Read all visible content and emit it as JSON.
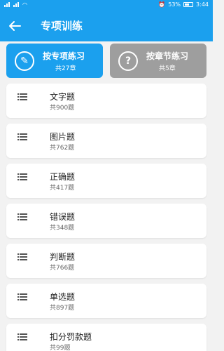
{
  "status": {
    "battery": "53%",
    "time": "3:44"
  },
  "header": {
    "title": "专项训练"
  },
  "modes": [
    {
      "label": "按专项练习",
      "count": "共27章",
      "icon": "pencil-circle-icon"
    },
    {
      "label": "按章节练习",
      "count": "共5章",
      "icon": "question-circle-icon"
    }
  ],
  "items": [
    {
      "title": "文字题",
      "count": "共900题"
    },
    {
      "title": "图片题",
      "count": "共762题"
    },
    {
      "title": "正确题",
      "count": "共417题"
    },
    {
      "title": "错误题",
      "count": "共348题"
    },
    {
      "title": "判断题",
      "count": "共766题"
    },
    {
      "title": "单选题",
      "count": "共897题"
    },
    {
      "title": "扣分罚款题",
      "count": "共99题"
    }
  ],
  "colors": {
    "primary": "#1ba0ee",
    "secondary": "#9e9e9e",
    "background": "#f2f2f2"
  }
}
